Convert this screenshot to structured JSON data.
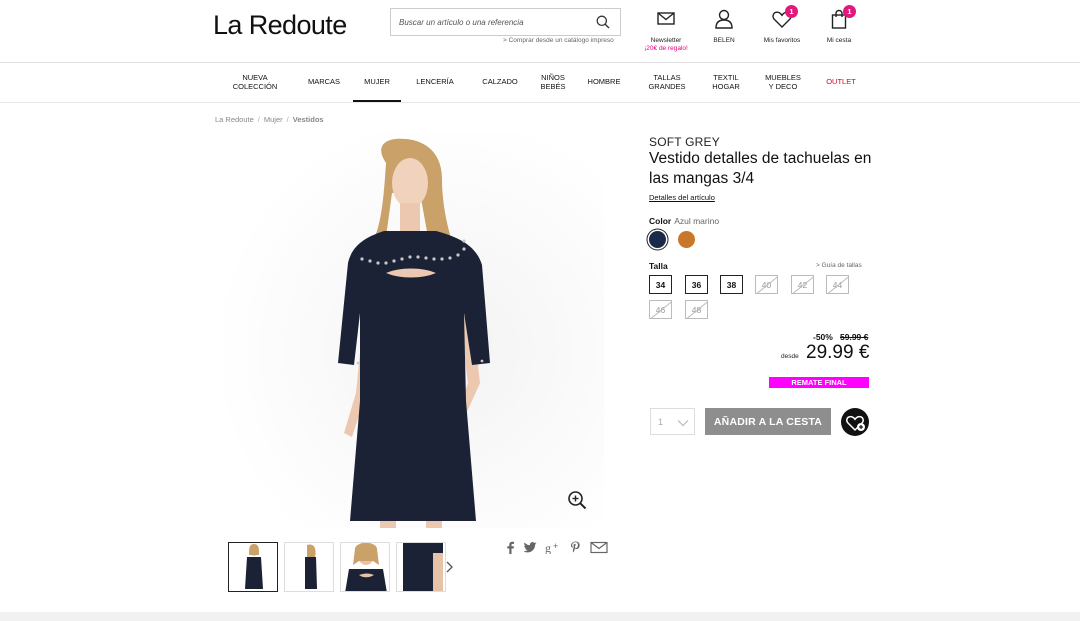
{
  "header": {
    "logo": "La Redoute",
    "search_placeholder": "Buscar un artículo o una referencia",
    "catalog_link": "> Comprar desde un catálogo impreso",
    "newsletter_label": "Newsletter",
    "newsletter_sub": "¡20€ de regalo!",
    "account_label": "BELEN",
    "favorites_label": "Mis favoritos",
    "favorites_count": "1",
    "cart_label": "Mi cesta",
    "cart_count": "1"
  },
  "nav": {
    "items": [
      {
        "label": "NUEVA\nCOLECCIÓN"
      },
      {
        "label": "MARCAS"
      },
      {
        "label": "MUJER"
      },
      {
        "label": "LENCERÍA"
      },
      {
        "label": "CALZADO"
      },
      {
        "label": "NIÑOS\nBEBÉS"
      },
      {
        "label": "HOMBRE"
      },
      {
        "label": "TALLAS\nGRANDES"
      },
      {
        "label": "TEXTIL\nHOGAR"
      },
      {
        "label": "MUEBLES\nY DECO"
      },
      {
        "label": "OUTLET"
      }
    ]
  },
  "breadcrumb": [
    "La Redoute",
    "Mujer",
    "Vestidos"
  ],
  "product": {
    "brand": "SOFT GREY",
    "title": "Vestido detalles de tachuelas en las mangas 3/4",
    "details_link": "Detalles del artículo",
    "color_label": "Color",
    "color_value": "Azul marino",
    "colors": [
      "#1c2a4a",
      "#c9782a"
    ],
    "size_label": "Talla",
    "size_guide": "> Guía de tallas",
    "sizes": [
      {
        "label": "34",
        "available": true
      },
      {
        "label": "36",
        "available": true
      },
      {
        "label": "38",
        "available": true
      },
      {
        "label": "40",
        "available": false
      },
      {
        "label": "42",
        "available": false
      },
      {
        "label": "44",
        "available": false
      },
      {
        "label": "46",
        "available": false
      },
      {
        "label": "48",
        "available": false
      }
    ],
    "discount": "-50%",
    "old_price": "59.99 €",
    "price_from": "desde",
    "price": "29.99 €",
    "badge": "REMATE FINAL",
    "quantity": "1",
    "add_to_cart": "AÑADIR A LA CESTA"
  },
  "share_icons": [
    "facebook-icon",
    "twitter-icon",
    "google-plus-icon",
    "pinterest-icon",
    "email-icon"
  ],
  "colors": {
    "accent_pink": "#e2187d",
    "outlet_red": "#e2001a",
    "remate_magenta": "#ff00ff",
    "cart_button": "#8e8e8e"
  }
}
